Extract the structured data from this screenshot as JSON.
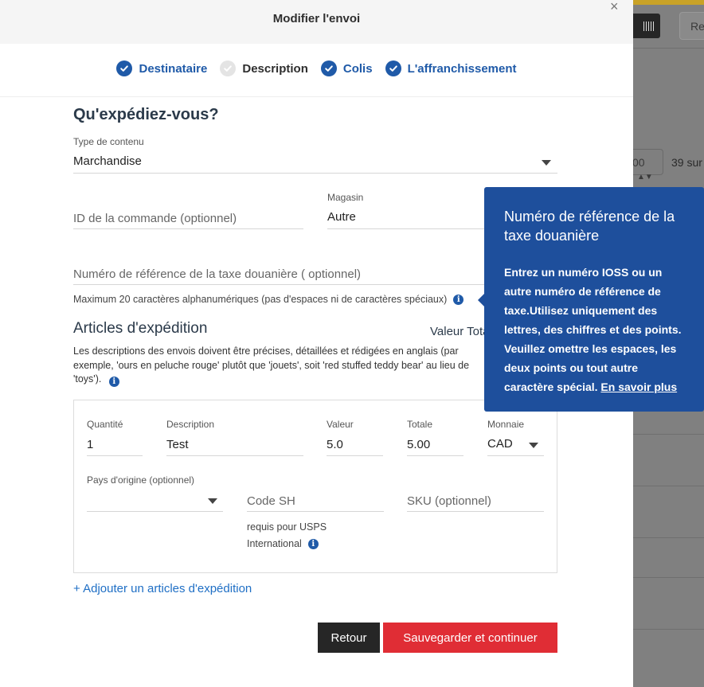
{
  "background": {
    "search_placeholder": "Re",
    "per_page": "00",
    "count_text": "39 sur"
  },
  "modal": {
    "title": "Modifier l'envoi",
    "close": "×"
  },
  "steps": [
    {
      "label": "Destinataire",
      "state": "done"
    },
    {
      "label": "Description",
      "state": "current"
    },
    {
      "label": "Colis",
      "state": "done"
    },
    {
      "label": "L'affranchissement",
      "state": "done"
    }
  ],
  "form": {
    "section_title": "Qu'expédiez-vous?",
    "content_type": {
      "label": "Type de contenu",
      "value": "Marchandise"
    },
    "order_id": {
      "placeholder": "ID de la commande (optionnel)"
    },
    "store": {
      "label": "Magasin",
      "value": "Autre"
    },
    "customs_ref": {
      "placeholder": "Numéro de référence de la taxe douanière ( optionnel)",
      "hint": "Maximum 20 caractères alphanumériques (pas d'espaces ni de caractères spéciaux)"
    }
  },
  "articles": {
    "title": "Articles d'expédition",
    "total_label": "Valeur Totale",
    "description": "Les descriptions des envois doivent être précises, détaillées et rédigées en anglais (par exemple, 'ours en peluche rouge' plutôt que 'jouets', soit 'red stuffed teddy bear' au lieu de 'toys').",
    "item": {
      "quantity": {
        "label": "Quantité",
        "value": "1"
      },
      "description": {
        "label": "Description",
        "value": "Test"
      },
      "value": {
        "label": "Valeur",
        "value": "5.0"
      },
      "total": {
        "label": "Totale",
        "value": "5.00"
      },
      "currency": {
        "label": "Monnaie",
        "value": "CAD"
      },
      "origin": {
        "label": "Pays d'origine (optionnel)",
        "value": ""
      },
      "hs_code": {
        "placeholder": "Code SH",
        "hint_line1": "requis pour USPS",
        "hint_line2": "International"
      },
      "sku": {
        "placeholder": "SKU (optionnel)"
      }
    },
    "add_link": "+ Adjouter un articles d'expédition"
  },
  "buttons": {
    "back": "Retour",
    "save": "Sauvegarder et continuer"
  },
  "tooltip": {
    "title": "Numéro de référence de la taxe douanière",
    "body": "Entrez un numéro IOSS ou un autre numéro de référence de taxe.Utilisez uniquement des lettres, des chiffres et des points. Veuillez omettre les espaces, les deux points ou tout autre caractère spécial.",
    "link": "En savoir plus"
  },
  "colors": {
    "primary_blue": "#1f5aa8",
    "tooltip_blue": "#1e4f9c",
    "save_red": "#e02d35",
    "back_dark": "#262626",
    "link_blue": "#1f6fc5"
  }
}
